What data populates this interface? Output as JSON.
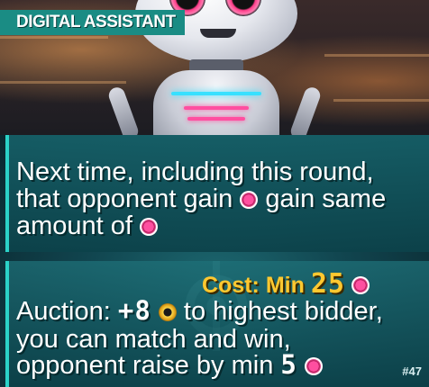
{
  "card": {
    "title": "DIGITAL ASSISTANT",
    "effect_line1": "Next time, including this round,",
    "effect_line2_a": "that opponent gain",
    "effect_line2_b": "gain same",
    "effect_line3": "amount of",
    "cost_label": "Cost: Min",
    "cost_value": "25",
    "auction_a": "Auction:",
    "auction_value": "+8",
    "auction_b": "to highest bidder,",
    "auction_line2": "you can match and win,",
    "auction_line3": "opponent raise by min",
    "raise_value": "5",
    "card_number": "#47"
  },
  "icons": {
    "pink_token": "pink-gem-token-icon",
    "gold_token": "gold-coin-icon"
  },
  "colors": {
    "accent": "#2bd2c8",
    "title_bg": "#1a8c84",
    "cost": "#ffc830",
    "token_pink": "#ff4fa0"
  }
}
